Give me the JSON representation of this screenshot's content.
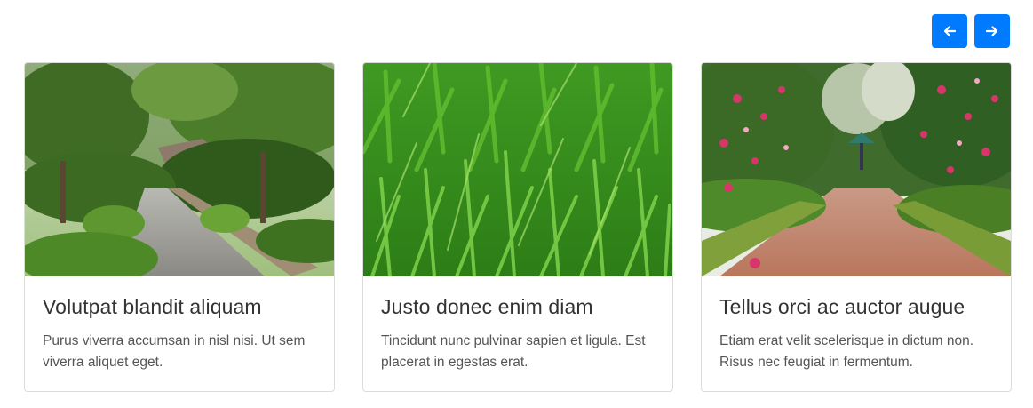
{
  "navigation": {
    "prev_icon": "arrow-left-icon",
    "next_icon": "arrow-right-icon",
    "button_color": "#007bff"
  },
  "cards": [
    {
      "title": "Volutpat blandit aliquam",
      "text": "Purus viverra accumsan in nisl nisi. Ut sem viverra aliquet eget.",
      "image": "garden-path-photo"
    },
    {
      "title": "Justo donec enim diam",
      "text": "Tincidunt nunc pulvinar sapien et ligula. Est placerat in egestas erat.",
      "image": "grass-closeup-photo"
    },
    {
      "title": "Tellus orci ac auctor augue",
      "text": "Etiam erat velit scelerisque in dictum non. Risus nec feugiat in fermentum.",
      "image": "flower-garden-path-photo"
    }
  ]
}
